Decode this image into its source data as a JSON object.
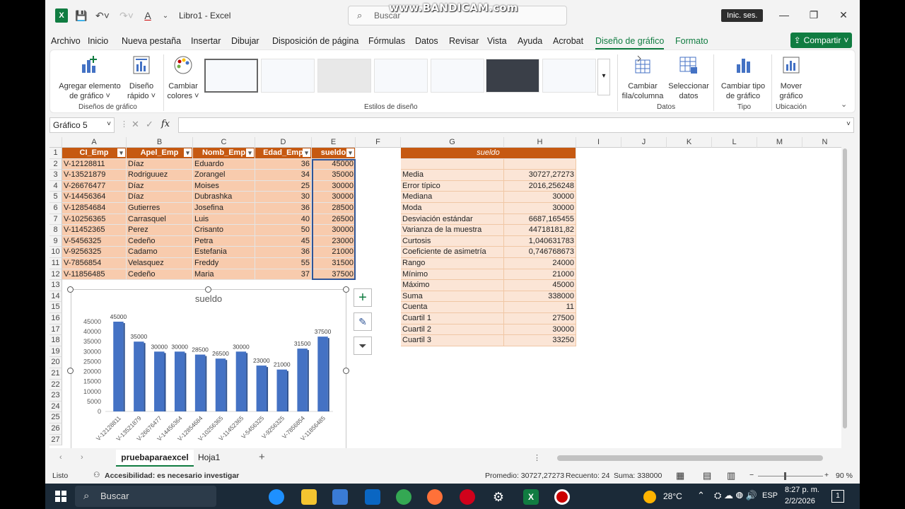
{
  "titlebar": {
    "title": "Libro1  -  Excel",
    "search_placeholder": "Buscar",
    "watermark": "www.BANDICAM.com",
    "signin": "Inic. ses."
  },
  "menu": {
    "items": [
      "Archivo",
      "Inicio",
      "Nueva pestaña",
      "Insertar",
      "Dibujar",
      "Disposición de página",
      "Fórmulas",
      "Datos",
      "Revisar",
      "Vista",
      "Ayuda",
      "Acrobat",
      "Diseño de gráfico",
      "Formato"
    ],
    "active": "Diseño de gráfico",
    "share": "Compartir"
  },
  "ribbon": {
    "add_element": [
      "Agregar elemento",
      "de gráfico ˅"
    ],
    "quick_layout": [
      "Diseño",
      "rápido ˅"
    ],
    "change_colors": [
      "Cambiar",
      "colores ˅"
    ],
    "switch_rowcol": [
      "Cambiar",
      "fila/columna"
    ],
    "select_data": [
      "Seleccionar",
      "datos"
    ],
    "change_type": [
      "Cambiar tipo",
      "de gráfico"
    ],
    "move_chart": [
      "Mover",
      "gráfico"
    ],
    "groups": {
      "layouts": "Diseños de gráfico",
      "styles": "Estilos de diseño",
      "data": "Datos",
      "type": "Tipo",
      "location": "Ubicación"
    }
  },
  "formula": {
    "namebox": "Gráfico 5",
    "fx": "fx"
  },
  "columns": [
    "A",
    "B",
    "C",
    "D",
    "E",
    "F",
    "G",
    "H",
    "I",
    "J",
    "K",
    "L",
    "M",
    "N"
  ],
  "rows": [
    "1",
    "2",
    "3",
    "4",
    "5",
    "6",
    "7",
    "8",
    "9",
    "10",
    "11",
    "12",
    "13",
    "14",
    "15",
    "16",
    "17",
    "18",
    "19",
    "20",
    "21",
    "22",
    "23",
    "24",
    "25",
    "26",
    "27"
  ],
  "table": {
    "headers": [
      "CI_Emp",
      "Apel_Emp",
      "Nomb_Emp",
      "Edad_Emp",
      "sueldo"
    ],
    "rows": [
      [
        "V-12128811",
        "Díaz",
        "Eduardo",
        "36",
        "45000"
      ],
      [
        "V-13521879",
        "Rodriguuez",
        "Zorangel",
        "34",
        "35000"
      ],
      [
        "V-26676477",
        "Díaz",
        "Moises",
        "25",
        "30000"
      ],
      [
        "V-14456364",
        "Díaz",
        "Dubrashka",
        "30",
        "30000"
      ],
      [
        "V-12854684",
        "Gutierres",
        "Josefina",
        "36",
        "28500"
      ],
      [
        "V-10256365",
        "Carrasquel",
        "Luis",
        "40",
        "26500"
      ],
      [
        "V-11452365",
        "Perez",
        "Crisanto",
        "50",
        "30000"
      ],
      [
        "V-5456325",
        "Cedeño",
        "Petra",
        "45",
        "23000"
      ],
      [
        "V-9256325",
        "Cadamo",
        "Estefania",
        "36",
        "21000"
      ],
      [
        "V-7856854",
        "Velasquez",
        "Freddy",
        "55",
        "31500"
      ],
      [
        "V-11856485",
        "Cedeño",
        "Maria",
        "37",
        "37500"
      ]
    ]
  },
  "stats": {
    "title": "sueldo",
    "rows": [
      [
        "Media",
        "30727,27273"
      ],
      [
        "Error típico",
        "2016,256248"
      ],
      [
        "Mediana",
        "30000"
      ],
      [
        "Moda",
        "30000"
      ],
      [
        "Desviación estándar",
        "6687,165455"
      ],
      [
        "Varianza de la muestra",
        "44718181,82"
      ],
      [
        "Curtosis",
        "1,040631783"
      ],
      [
        "Coeficiente de asimetría",
        "0,746768673"
      ],
      [
        "Rango",
        "24000"
      ],
      [
        "Mínimo",
        "21000"
      ],
      [
        "Máximo",
        "45000"
      ],
      [
        "Suma",
        "338000"
      ],
      [
        "Cuenta",
        "11"
      ],
      [
        "Cuartil 1",
        "27500"
      ],
      [
        "Cuartil 2",
        "30000"
      ],
      [
        "Cuartil 3",
        "33250"
      ]
    ]
  },
  "chart_data": {
    "type": "bar",
    "title": "sueldo",
    "categories": [
      "V-12128811",
      "V-13521879",
      "V-26676477",
      "V-14456364",
      "V-12854684",
      "V-10256365",
      "V-11452365",
      "V-5456325",
      "V-9256325",
      "V-7856854",
      "V-11856485"
    ],
    "values": [
      45000,
      35000,
      30000,
      30000,
      28500,
      26500,
      30000,
      23000,
      21000,
      31500,
      37500
    ],
    "yticks": [
      "45000",
      "40000",
      "35000",
      "30000",
      "25000",
      "20000",
      "15000",
      "10000",
      "5000",
      "0"
    ],
    "ylim": [
      0,
      45000
    ],
    "bar_color": "#4472c4",
    "data_labels": true,
    "grid": false
  },
  "sheets": {
    "tabs": [
      "pruebaparaexcel",
      "Hoja1"
    ],
    "active": "pruebaparaexcel",
    "add": "+"
  },
  "statusbar": {
    "ready": "Listo",
    "accessibility": "Accesibilidad: es necesario investigar",
    "average": "Promedio: 30727,27273",
    "count": "Recuento: 24",
    "sum": "Suma: 338000",
    "zoom": "90 %"
  },
  "taskbar": {
    "search": "Buscar",
    "temp": "28°C",
    "lang": "ESP",
    "time": "8:27 p. m.",
    "date": "2/2/2026",
    "notif": "1"
  }
}
